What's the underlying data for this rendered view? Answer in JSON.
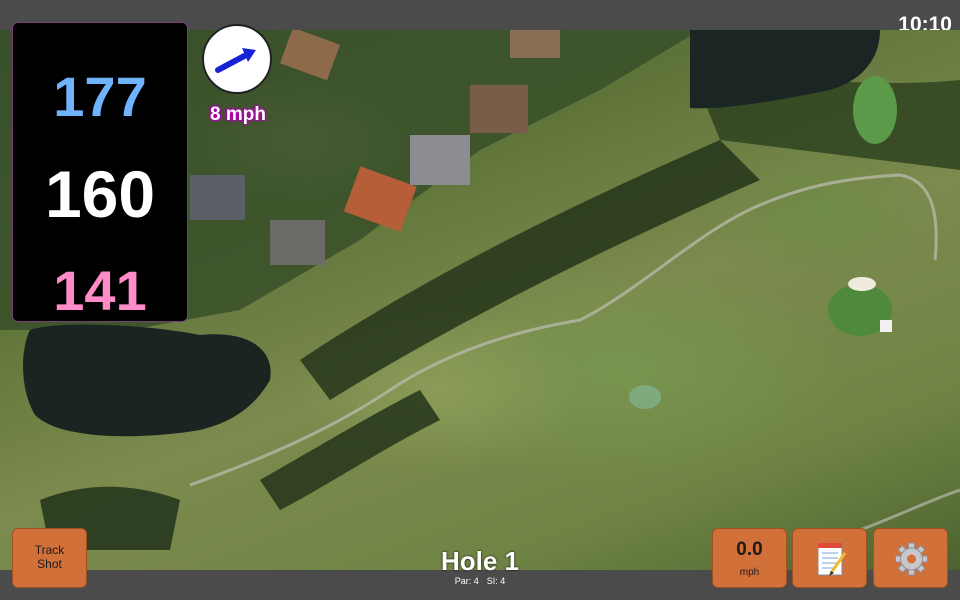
{
  "status": {
    "time": "10:10"
  },
  "yardages": {
    "back": "177",
    "middle": "160",
    "front": "141"
  },
  "wind": {
    "speed_label": "8 mph",
    "arrow_icon": "wind-direction-arrow-icon"
  },
  "hole": {
    "title": "Hole 1",
    "par_label": "Par: 4",
    "si_label": "SI: 4"
  },
  "buttons": {
    "track_shot": "Track\nShot",
    "wind_value": "0.0",
    "wind_unit": "mph",
    "scorecard_icon": "notepad-icon",
    "settings_icon": "gear-icon"
  },
  "colors": {
    "back": "#6fb3ff",
    "middle": "#ffffff",
    "front": "#ff8cc8",
    "button": "#d2703a",
    "wind_text_glow": "#b000b0"
  }
}
